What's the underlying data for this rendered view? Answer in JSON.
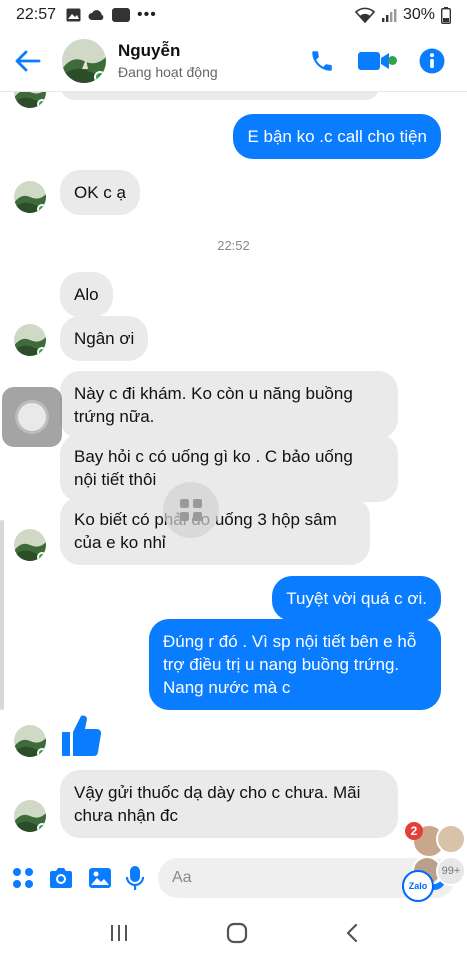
{
  "status_bar": {
    "time": "22:57",
    "battery": "30%",
    "app_icons": [
      "image-icon",
      "cloud-icon",
      "zalo-icon",
      "more-icon"
    ]
  },
  "header": {
    "name": "Nguyễn",
    "status": "Đang hoạt động",
    "actions": [
      "phone-icon",
      "video-call-icon",
      "info-icon"
    ]
  },
  "messages": {
    "m1": "E bận ko .c call cho tiện",
    "m2": "OK c ạ",
    "timestamp": "22:52",
    "m3": "Alo",
    "m4": "Ngân ơi",
    "m5": [
      "Này c đi khám. Ko còn u năng buồng",
      "trứng nữa."
    ],
    "m6": [
      "Bay hỏi c có uống gì ko . C bảo uống",
      "nội tiết thôi"
    ],
    "m7": [
      "Ko biết có phải do uống 3 hộp  sâm",
      "của e ko nhỉ"
    ],
    "m8": "Tuyệt vời quá c ơi.",
    "m9": [
      "Đúng r đó . Vì sp nội tiết bên e hỗ",
      "trợ điều trị u nang buồng trứng.",
      "Nang nước mà c"
    ],
    "m10": [
      "Vậy gửi thuốc dạ dày cho c chưa. Mãi",
      "chưa nhận đc"
    ]
  },
  "composer": {
    "placeholder": "Aa"
  },
  "chat_heads": {
    "badge": "2",
    "count": "99+",
    "zalo_label": "Zalo"
  },
  "colors": {
    "accent": "#0a7cff",
    "incoming": "#eaeaea",
    "online": "#31a24c"
  }
}
